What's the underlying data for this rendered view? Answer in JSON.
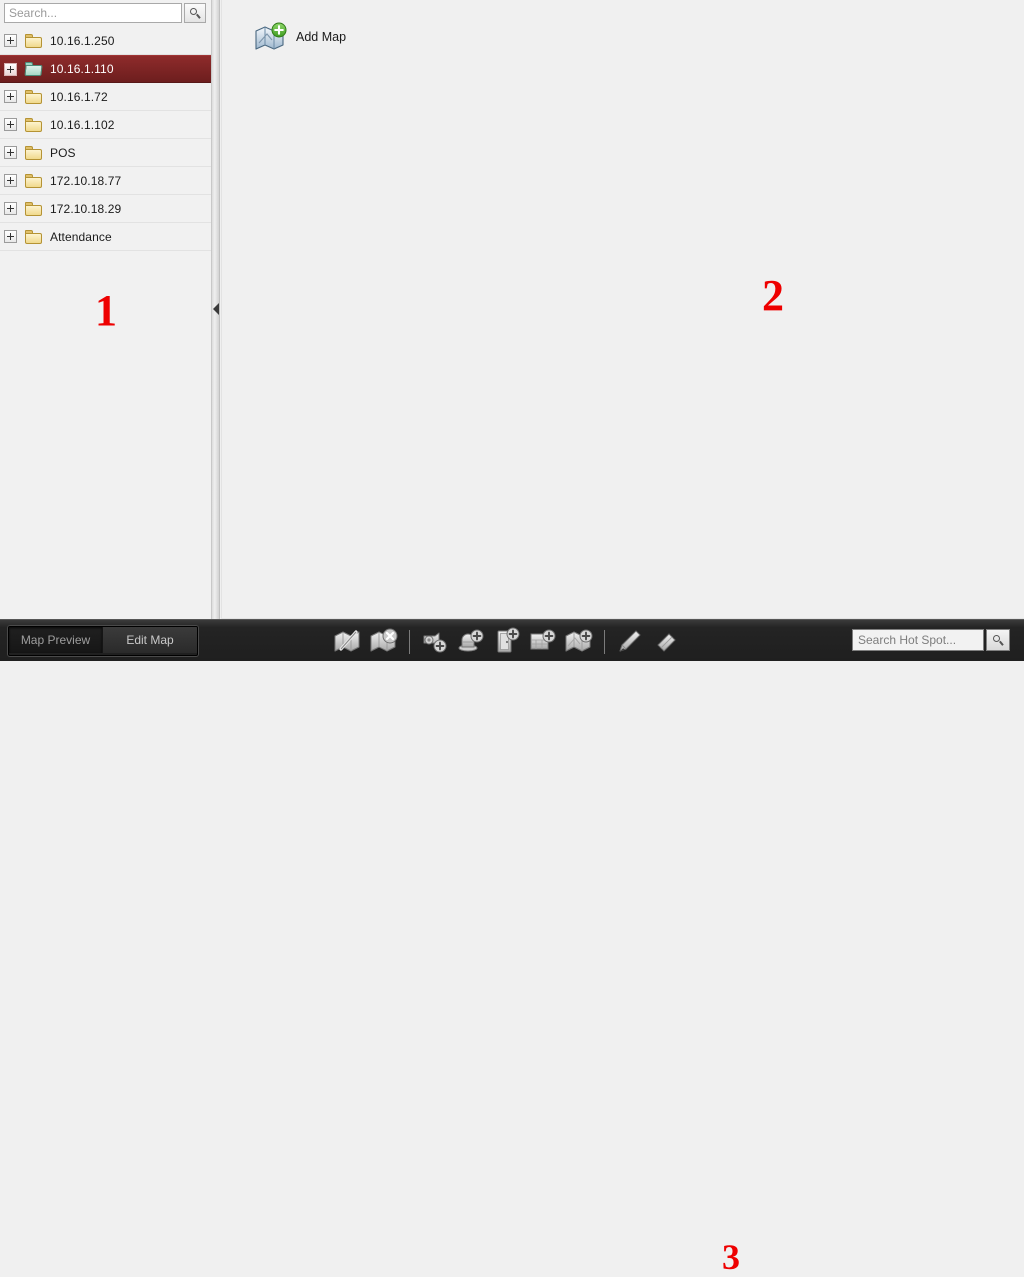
{
  "sidebar": {
    "search": {
      "placeholder": "Search...",
      "value": "",
      "icon": "search-icon"
    },
    "tree": [
      {
        "label": "10.16.1.250",
        "icon": "folder-closed-icon",
        "selected": false
      },
      {
        "label": "10.16.1.110",
        "icon": "folder-open-icon",
        "selected": true
      },
      {
        "label": "10.16.1.72",
        "icon": "folder-closed-icon",
        "selected": false
      },
      {
        "label": "10.16.1.102",
        "icon": "folder-closed-icon",
        "selected": false
      },
      {
        "label": "POS",
        "icon": "folder-closed-icon",
        "selected": false
      },
      {
        "label": "172.10.18.77",
        "icon": "folder-closed-icon",
        "selected": false
      },
      {
        "label": "172.10.18.29",
        "icon": "folder-closed-icon",
        "selected": false
      },
      {
        "label": "Attendance",
        "icon": "folder-closed-icon",
        "selected": false
      }
    ],
    "collapse_icon": "chevron-left-icon"
  },
  "main": {
    "add_map": {
      "label": "Add Map",
      "icon": "add-map-icon"
    }
  },
  "annotations": [
    {
      "id": "1",
      "text": "1",
      "color": "#ee0000"
    },
    {
      "id": "2",
      "text": "2",
      "color": "#ee0000"
    },
    {
      "id": "3",
      "text": "3",
      "color": "#ee0000"
    }
  ],
  "toolbar": {
    "tabs": [
      {
        "label": "Map Preview",
        "active": true
      },
      {
        "label": "Edit Map",
        "active": false
      }
    ],
    "tools": [
      {
        "name": "modify-map-icon",
        "title": "Modify Map"
      },
      {
        "name": "delete-map-icon",
        "title": "Delete Map"
      },
      {
        "name": "separator",
        "title": ""
      },
      {
        "name": "add-camera-icon",
        "title": "Add Camera"
      },
      {
        "name": "add-alarm-output-icon",
        "title": "Add Alarm Output"
      },
      {
        "name": "add-door-icon",
        "title": "Add Door"
      },
      {
        "name": "add-zone-icon",
        "title": "Add Zone"
      },
      {
        "name": "add-sub-map-icon",
        "title": "Add Sub Map"
      },
      {
        "name": "separator",
        "title": ""
      },
      {
        "name": "pencil-icon",
        "title": "Draw Region"
      },
      {
        "name": "eraser-icon",
        "title": "Clear Region"
      }
    ],
    "hot_spot_search": {
      "placeholder": "Search Hot Spot...",
      "value": "",
      "icon": "search-icon"
    }
  },
  "colors": {
    "selection": "#8e2b2b",
    "annotation": "#ee0000",
    "toolbar_bg": "#242424",
    "panel_bg": "#f0f0f0",
    "sidebar_bg": "#f1f1f1"
  }
}
